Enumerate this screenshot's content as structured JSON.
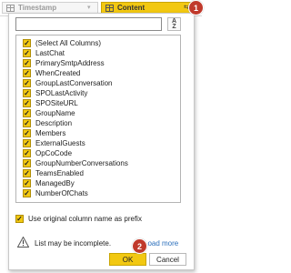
{
  "header": {
    "timestamp_col": "Timestamp",
    "content_col": "Content"
  },
  "badges": {
    "first": "1",
    "second": "2"
  },
  "filter": {
    "search_value": "",
    "sort_icon_top": "A",
    "sort_icon_bottom": "Z",
    "items": [
      {
        "label": "(Select All Columns)",
        "checked": true
      },
      {
        "label": "LastChat",
        "checked": true
      },
      {
        "label": "PrimarySmtpAddress",
        "checked": true
      },
      {
        "label": "WhenCreated",
        "checked": true
      },
      {
        "label": "GroupLastConversation",
        "checked": true
      },
      {
        "label": "SPOLastActivity",
        "checked": true
      },
      {
        "label": "SPOSiteURL",
        "checked": true
      },
      {
        "label": "GroupName",
        "checked": true
      },
      {
        "label": "Description",
        "checked": true
      },
      {
        "label": "Members",
        "checked": true
      },
      {
        "label": "ExternalGuests",
        "checked": true
      },
      {
        "label": "OpCoCode",
        "checked": true
      },
      {
        "label": "GroupNumberConversations",
        "checked": true
      },
      {
        "label": "TeamsEnabled",
        "checked": true
      },
      {
        "label": "ManagedBy",
        "checked": true
      },
      {
        "label": "NumberOfChats",
        "checked": true
      }
    ],
    "prefix_option": {
      "label": "Use original column name as prefix",
      "checked": true
    },
    "warning_text": "List may be incomplete.",
    "load_more": "Load more",
    "ok_label": "OK",
    "cancel_label": "Cancel"
  },
  "colors": {
    "accent": "#f2c811",
    "badge": "#c0392b",
    "link": "#2a6ebb"
  }
}
